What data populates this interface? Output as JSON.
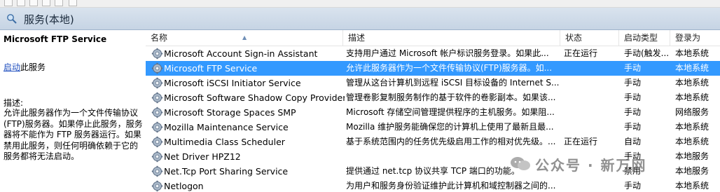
{
  "window_title": "服务(本地)",
  "left_panel": {
    "selected_service_name": "Microsoft FTP Service",
    "start_link": "启动",
    "start_suffix": "此服务",
    "description_label": "描述:",
    "description_text": "允许此服务器作为一个文件传输协议(FTP)服务器。如果停止此服务，服务器将不能作为 FTP 服务器运行。如果禁用此服务，则任何明确依赖于它的服务都将无法启动。"
  },
  "columns": {
    "name": "名称",
    "description": "描述",
    "status": "状态",
    "startup_type": "启动类型",
    "logon_as": "登录为"
  },
  "services": [
    {
      "name": "Microsoft Account Sign-in Assistant",
      "description": "支持用户通过 Microsoft 帐户标识服务登录。如果此...",
      "status": "正在运行",
      "startup": "手动(触发...",
      "logon": "本地系统",
      "selected": false
    },
    {
      "name": "Microsoft FTP Service",
      "description": "允许此服务器作为一个文件传输协议(FTP)服务器。如...",
      "status": "",
      "startup": "手动",
      "logon": "本地系统",
      "selected": true
    },
    {
      "name": "Microsoft iSCSI Initiator Service",
      "description": "管理从这台计算机到远程 iSCSI 目标设备的 Internet S...",
      "status": "",
      "startup": "手动",
      "logon": "本地系统",
      "selected": false
    },
    {
      "name": "Microsoft Software Shadow Copy Provider",
      "description": "管理卷影复制服务制作的基于软件的卷影副本。如果该...",
      "status": "",
      "startup": "手动",
      "logon": "本地系统",
      "selected": false
    },
    {
      "name": "Microsoft Storage Spaces SMP",
      "description": "Microsoft 存储空间管理提供程序的主机服务。如果阻...",
      "status": "",
      "startup": "手动",
      "logon": "网络服务",
      "selected": false
    },
    {
      "name": "Mozilla Maintenance Service",
      "description": "Mozilla 维护服务能确保您的计算机上使用了最新且最...",
      "status": "",
      "startup": "手动",
      "logon": "本地系统",
      "selected": false
    },
    {
      "name": "Multimedia Class Scheduler",
      "description": "基于系统范围内的任务优先级启用工作的相对优先级。...",
      "status": "正在运行",
      "startup": "自动",
      "logon": "本地系统",
      "selected": false
    },
    {
      "name": "Net Driver HPZ12",
      "description": "",
      "status": "",
      "startup": "手动",
      "logon": "本地服务",
      "selected": false
    },
    {
      "name": "Net.Tcp Port Sharing Service",
      "description": "提供通过 net.tcp 协议共享 TCP 端口的功能。",
      "status": "",
      "startup": "禁用",
      "logon": "本地服务",
      "selected": false
    },
    {
      "name": "Netlogon",
      "description": "为用户和服务身份验证维护此计算机和域控制器之间的...",
      "status": "",
      "startup": "手动",
      "logon": "本地系统",
      "selected": false
    }
  ],
  "watermark": "公众号 · 新万网",
  "icons": {
    "header": "services-icon",
    "service": "gear-icon"
  },
  "colors": {
    "selection": "#3399ff",
    "link": "#1f4fbf"
  }
}
